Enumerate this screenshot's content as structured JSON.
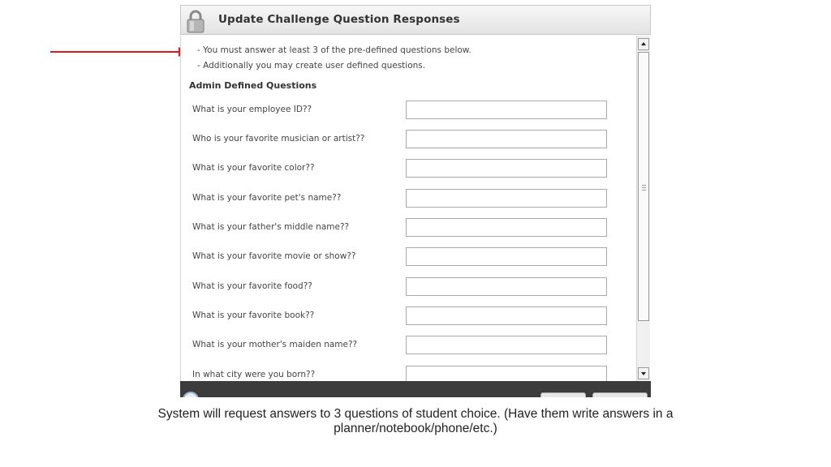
{
  "dialog": {
    "title": "Update Challenge Question Responses",
    "instructions": [
      "- You must answer at least 3 of the pre-defined questions below.",
      "- Additionally you may create user defined questions."
    ],
    "section_title": "Admin Defined Questions",
    "questions": [
      {
        "label": "What is your employee ID??",
        "value": ""
      },
      {
        "label": "Who is your favorite musician or artist??",
        "value": ""
      },
      {
        "label": "What is your favorite color??",
        "value": ""
      },
      {
        "label": "What is your favorite pet's name??",
        "value": ""
      },
      {
        "label": "What is your father's middle name??",
        "value": ""
      },
      {
        "label": "What is your favorite movie or show??",
        "value": ""
      },
      {
        "label": "What is your favorite food??",
        "value": ""
      },
      {
        "label": "What is your favorite book??",
        "value": ""
      },
      {
        "label": "What is your mother's maiden name??",
        "value": ""
      },
      {
        "label": "In what city were you born??",
        "value": ""
      }
    ]
  },
  "annotation": {
    "arrow_color": "#e3161c",
    "caption_line1": "System will request answers to 3 questions of student choice. (Have them write answers in a",
    "caption_line2": "planner/notebook/phone/etc.)"
  },
  "icons": {
    "title": "lock-icon",
    "footer": "info-icon"
  }
}
